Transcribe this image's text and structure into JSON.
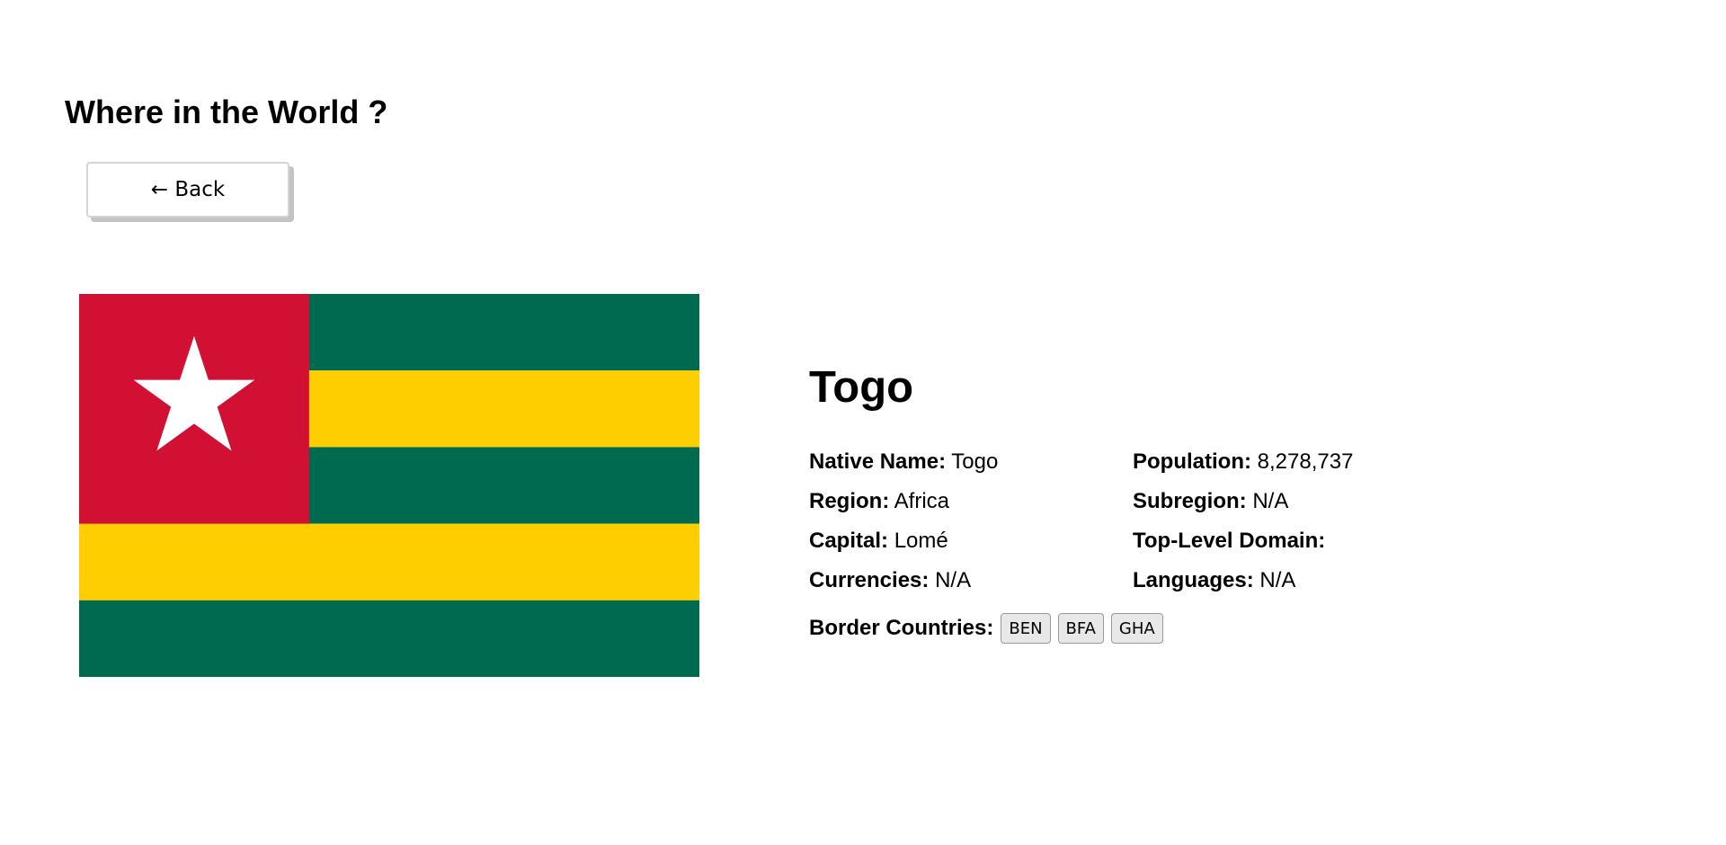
{
  "header": {
    "title": "Where in the World ?"
  },
  "back_button": {
    "label": "← Back"
  },
  "country": {
    "name": "Togo",
    "flag": {
      "alt": "Flag of Togo",
      "colors": {
        "red": "#d21034",
        "green": "#006a4e",
        "yellow": "#ffce00",
        "star": "#ffffff"
      }
    },
    "info_left": [
      {
        "label": "Native Name:",
        "value": "Togo"
      },
      {
        "label": "Region:",
        "value": "Africa"
      },
      {
        "label": "Capital:",
        "value": "Lomé"
      },
      {
        "label": "Currencies:",
        "value": "N/A"
      }
    ],
    "info_right": [
      {
        "label": "Population:",
        "value": "8,278,737"
      },
      {
        "label": "Subregion:",
        "value": "N/A"
      },
      {
        "label": "Top-Level Domain:",
        "value": ""
      },
      {
        "label": "Languages:",
        "value": "N/A"
      }
    ],
    "border_countries": {
      "label": "Border Countries:",
      "items": [
        "BEN",
        "BFA",
        "GHA"
      ]
    }
  }
}
